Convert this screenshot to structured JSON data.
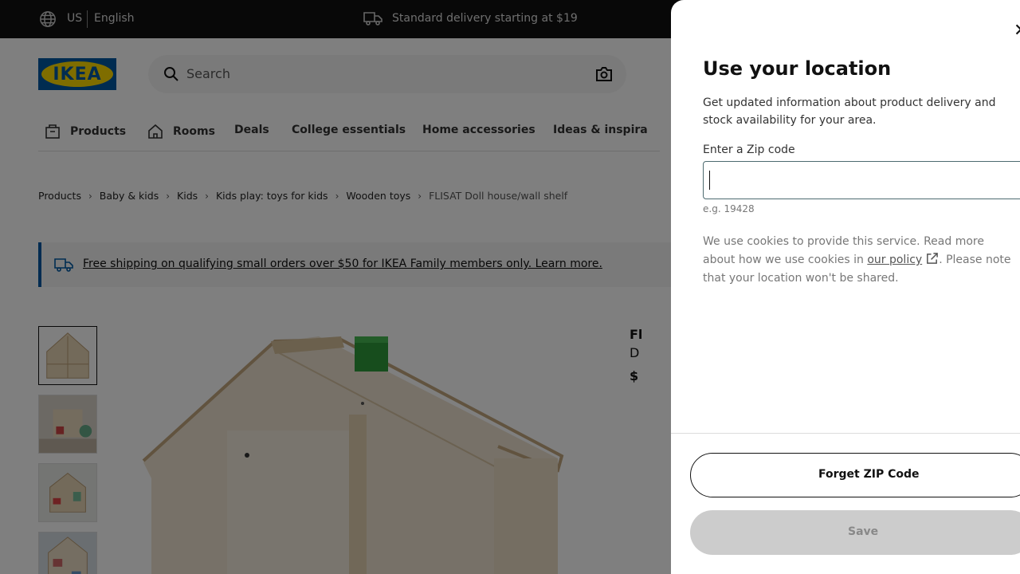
{
  "topbar": {
    "country": "US",
    "language": "English",
    "delivery": "Standard delivery starting at $19"
  },
  "header": {
    "logo_text": "IKEA",
    "search_placeholder": "Search"
  },
  "nav": {
    "items": [
      "Products",
      "Rooms",
      "Deals",
      "College essentials",
      "Home accessories",
      "Ideas & inspira"
    ]
  },
  "breadcrumb": {
    "items": [
      "Products",
      "Baby & kids",
      "Kids",
      "Kids play: toys for kids",
      "Wooden toys",
      "FLISAT Doll house/wall shelf"
    ]
  },
  "promo": {
    "text": "Free shipping on qualifying small orders over $50 for IKEA Family members only. Learn more."
  },
  "product_partial": {
    "name_start": "Fl",
    "desc_start": "D",
    "price_start": "$"
  },
  "modal": {
    "title": "Use your location",
    "description": "Get updated information about product delivery and stock availability for your area.",
    "zip_label": "Enter a Zip code",
    "zip_value": "",
    "zip_hint": "e.g. 19428",
    "cookie_before": "We use cookies to provide this service. Read more about how we use cookies in ",
    "cookie_link": "our policy",
    "cookie_after": ". Please note that your location won't be shared.",
    "forget_label": "Forget ZIP Code",
    "save_label": "Save"
  },
  "colors": {
    "ikea_blue": "#0058a3",
    "ikea_yellow": "#ffdb00",
    "topbar_bg": "#111111",
    "save_disabled": "#cccccc"
  }
}
